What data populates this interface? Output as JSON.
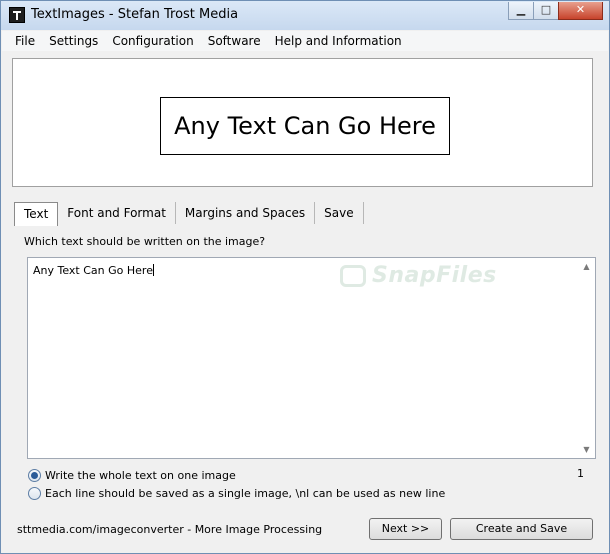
{
  "window": {
    "title": "TextImages - Stefan Trost Media",
    "minimize_glyph": "▁",
    "maximize_glyph": "□",
    "close_glyph": "✕"
  },
  "menu": [
    {
      "label": "File"
    },
    {
      "label": "Settings"
    },
    {
      "label": "Configuration"
    },
    {
      "label": "Software"
    },
    {
      "label": "Help and Information"
    }
  ],
  "preview": {
    "text": "Any Text Can Go Here"
  },
  "tabs": [
    {
      "label": "Text",
      "active": true
    },
    {
      "label": "Font and Format",
      "active": false
    },
    {
      "label": "Margins and Spaces",
      "active": false
    },
    {
      "label": "Save",
      "active": false
    }
  ],
  "text_panel": {
    "prompt": "Which text should be written on the image?",
    "value": "Any Text Can Go Here",
    "watermark": "SnapFiles",
    "line_count": "1",
    "options": [
      {
        "label": "Write the whole text on one image",
        "checked": true
      },
      {
        "label": "Each line should be saved as a single image, \\nl can be used as new line",
        "checked": false
      }
    ]
  },
  "footer": {
    "link": "sttmedia.com/imageconverter - More Image Processing",
    "next_label": "Next >>",
    "create_label": "Create and Save"
  }
}
